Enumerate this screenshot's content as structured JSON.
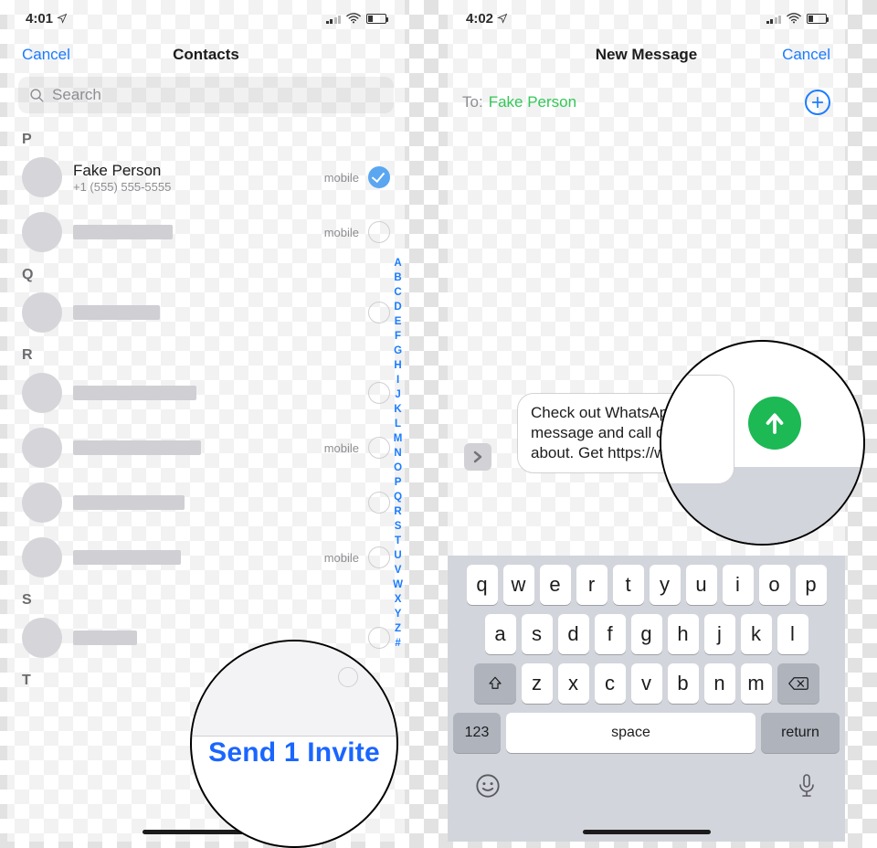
{
  "left": {
    "statusbar": {
      "time": "4:01"
    },
    "nav": {
      "cancel": "Cancel",
      "title": "Contacts"
    },
    "search": {
      "placeholder": "Search"
    },
    "sections": [
      {
        "letter": "P",
        "rows": [
          {
            "name": "Fake Person",
            "sub": "+1 (555) 555-5555",
            "tag": "mobile",
            "checked": true
          },
          {
            "name": "",
            "sub": "",
            "tag": "mobile",
            "checked": false
          }
        ]
      },
      {
        "letter": "Q",
        "rows": [
          {
            "name": "",
            "sub": "",
            "tag": "",
            "checked": false
          }
        ]
      },
      {
        "letter": "R",
        "rows": [
          {
            "name": "",
            "sub": "",
            "tag": "",
            "checked": false
          },
          {
            "name": "",
            "sub": "",
            "tag": "mobile",
            "checked": false
          },
          {
            "name": "",
            "sub": "",
            "tag": "",
            "checked": false
          },
          {
            "name": "",
            "sub": "",
            "tag": "mobile",
            "checked": false
          }
        ]
      },
      {
        "letter": "S",
        "rows": [
          {
            "name": "",
            "sub": "",
            "tag": "",
            "checked": false
          }
        ]
      },
      {
        "letter": "T",
        "rows": []
      }
    ],
    "index": [
      "A",
      "B",
      "C",
      "D",
      "E",
      "F",
      "G",
      "H",
      "I",
      "J",
      "K",
      "L",
      "M",
      "N",
      "O",
      "P",
      "Q",
      "R",
      "S",
      "T",
      "U",
      "V",
      "W",
      "X",
      "Y",
      "Z",
      "#"
    ],
    "callout": "Send 1 Invite"
  },
  "right": {
    "statusbar": {
      "time": "4:02"
    },
    "nav": {
      "title": "New Message",
      "cancel": "Cancel"
    },
    "to": {
      "label": "To:",
      "name": "Fake Person"
    },
    "message": "Check out WhatsApp message and call care about. Get https://whatsapp",
    "keyboard": {
      "r1": [
        "q",
        "w",
        "e",
        "r",
        "t",
        "y",
        "u",
        "i",
        "o",
        "p"
      ],
      "r2": [
        "a",
        "s",
        "d",
        "f",
        "g",
        "h",
        "j",
        "k",
        "l"
      ],
      "r3": [
        "z",
        "x",
        "c",
        "v",
        "b",
        "n",
        "m"
      ],
      "num": "123",
      "space": "space",
      "ret": "return"
    }
  }
}
